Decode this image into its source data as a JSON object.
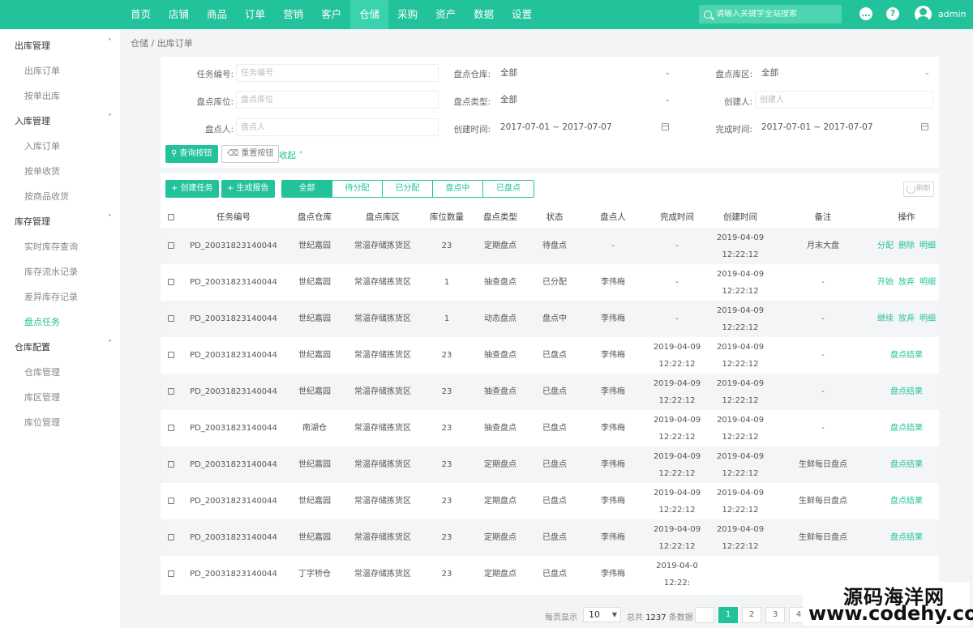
{
  "topnav": {
    "items": [
      "首页",
      "店铺",
      "商品",
      "订单",
      "营销",
      "客户",
      "仓储",
      "采购",
      "资产",
      "数据",
      "设置"
    ],
    "active_index": 6,
    "search_placeholder": "请输入关键字全站搜索",
    "user": "admin"
  },
  "sidebar": {
    "groups": [
      {
        "title": "出库管理",
        "items": [
          "出库订单",
          "按单出库"
        ]
      },
      {
        "title": "入库管理",
        "items": [
          "入库订单",
          "按单收货",
          "按商品收货"
        ]
      },
      {
        "title": "库存管理",
        "items": [
          "实时库存查询",
          "库存流水记录",
          "差异库存记录",
          "盘点任务"
        ]
      },
      {
        "title": "仓库配置",
        "items": [
          "仓库管理",
          "库区管理",
          "库位管理"
        ]
      }
    ],
    "active_item": "盘点任务"
  },
  "breadcrumb": "仓储 / 出库订单",
  "filter": {
    "task_no_label": "任务编号:",
    "task_no_placeholder": "任务编号",
    "warehouse_label": "盘点仓库:",
    "warehouse_value": "全部",
    "zone_label": "盘点库区:",
    "zone_value": "全部",
    "location_label": "盘点库位:",
    "location_placeholder": "盘点库位",
    "type_label": "盘点类型:",
    "type_value": "全部",
    "creator_label": "创建人:",
    "creator_placeholder": "创建人",
    "counter_label": "盘点人:",
    "counter_placeholder": "盘点人",
    "created_label": "创建时间:",
    "created_value": "2017-07-01 ~ 2017-07-07",
    "finished_label": "完成时间:",
    "finished_value": "2017-07-01 ~ 2017-07-07",
    "query_button": "查询按钮",
    "reset_button": "重置按钮",
    "collapse_link": "收起"
  },
  "toolbar": {
    "create_button": "+ 创建任务",
    "report_button": "+ 生成报告",
    "tabs": [
      "全部",
      "待分配",
      "已分配",
      "盘点中",
      "已盘点"
    ],
    "active_tab": 0,
    "refresh_button": "刷新"
  },
  "table": {
    "headers": [
      "任务编号",
      "盘点仓库",
      "盘点库区",
      "库位数量",
      "盘点类型",
      "状态",
      "盘点人",
      "完成时间",
      "创建时间",
      "备注",
      "操作"
    ],
    "rows": [
      {
        "no": "PD_20031823140044",
        "wh": "世纪嘉园",
        "zone": "常温存储拣货区",
        "qty": "23",
        "type": "定期盘点",
        "status": "待盘点",
        "person": "-",
        "done_date": "-",
        "done_time": "",
        "create_date": "2019-04-09",
        "create_time": "12:22:12",
        "remark": "月末大盘",
        "ops": [
          "分配",
          "删除",
          "明细"
        ]
      },
      {
        "no": "PD_20031823140044",
        "wh": "世纪嘉园",
        "zone": "常温存储拣货区",
        "qty": "1",
        "type": "抽查盘点",
        "status": "已分配",
        "person": "李伟梅",
        "done_date": "-",
        "done_time": "",
        "create_date": "2019-04-09",
        "create_time": "12:22:12",
        "remark": "-",
        "ops": [
          "开始",
          "放弃",
          "明细"
        ]
      },
      {
        "no": "PD_20031823140044",
        "wh": "世纪嘉园",
        "zone": "常温存储拣货区",
        "qty": "1",
        "type": "动态盘点",
        "status": "盘点中",
        "person": "李伟梅",
        "done_date": "-",
        "done_time": "",
        "create_date": "2019-04-09",
        "create_time": "12:22:12",
        "remark": "-",
        "ops": [
          "继续",
          "放弃",
          "明细"
        ]
      },
      {
        "no": "PD_20031823140044",
        "wh": "世纪嘉园",
        "zone": "常温存储拣货区",
        "qty": "23",
        "type": "抽查盘点",
        "status": "已盘点",
        "person": "李伟梅",
        "done_date": "2019-04-09",
        "done_time": "12:22:12",
        "create_date": "2019-04-09",
        "create_time": "12:22:12",
        "remark": "-",
        "ops": [
          "盘点结果"
        ]
      },
      {
        "no": "PD_20031823140044",
        "wh": "世纪嘉园",
        "zone": "常温存储拣货区",
        "qty": "23",
        "type": "抽查盘点",
        "status": "已盘点",
        "person": "李伟梅",
        "done_date": "2019-04-09",
        "done_time": "12:22:12",
        "create_date": "2019-04-09",
        "create_time": "12:22:12",
        "remark": "-",
        "ops": [
          "盘点结果"
        ]
      },
      {
        "no": "PD_20031823140044",
        "wh": "南湖仓",
        "zone": "常温存储拣货区",
        "qty": "23",
        "type": "抽查盘点",
        "status": "已盘点",
        "person": "李伟梅",
        "done_date": "2019-04-09",
        "done_time": "12:22:12",
        "create_date": "2019-04-09",
        "create_time": "12:22:12",
        "remark": "-",
        "ops": [
          "盘点结果"
        ]
      },
      {
        "no": "PD_20031823140044",
        "wh": "世纪嘉园",
        "zone": "常温存储拣货区",
        "qty": "23",
        "type": "定期盘点",
        "status": "已盘点",
        "person": "李伟梅",
        "done_date": "2019-04-09",
        "done_time": "12:22:12",
        "create_date": "2019-04-09",
        "create_time": "12:22:12",
        "remark": "生鲜每日盘点",
        "ops": [
          "盘点结果"
        ]
      },
      {
        "no": "PD_20031823140044",
        "wh": "世纪嘉园",
        "zone": "常温存储拣货区",
        "qty": "23",
        "type": "定期盘点",
        "status": "已盘点",
        "person": "李伟梅",
        "done_date": "2019-04-09",
        "done_time": "12:22:12",
        "create_date": "2019-04-09",
        "create_time": "12:22:12",
        "remark": "生鲜每日盘点",
        "ops": [
          "盘点结果"
        ]
      },
      {
        "no": "PD_20031823140044",
        "wh": "世纪嘉园",
        "zone": "常温存储拣货区",
        "qty": "23",
        "type": "定期盘点",
        "status": "已盘点",
        "person": "李伟梅",
        "done_date": "2019-04-09",
        "done_time": "12:22:12",
        "create_date": "2019-04-09",
        "create_time": "12:22:12",
        "remark": "生鲜每日盘点",
        "ops": [
          "盘点结果"
        ]
      },
      {
        "no": "PD_20031823140044",
        "wh": "丁字桥仓",
        "zone": "常温存储拣货区",
        "qty": "23",
        "type": "定期盘点",
        "status": "已盘点",
        "person": "李伟梅",
        "done_date": "2019-04-0",
        "done_time": "12:22:",
        "create_date": "",
        "create_time": "",
        "remark": "",
        "ops": []
      }
    ]
  },
  "pager": {
    "per_page_label": "每页显示",
    "per_page_value": "10",
    "total_prefix": "总共",
    "total_count": "1237",
    "total_suffix": "条数据",
    "pages": [
      "1",
      "2",
      "3",
      "4"
    ],
    "active_page": "1"
  },
  "watermark": {
    "title": "源码海洋网",
    "url": "www.codehy.com"
  },
  "colors": {
    "brand": "#22c29a",
    "nav_active": "#3bd3ad"
  }
}
